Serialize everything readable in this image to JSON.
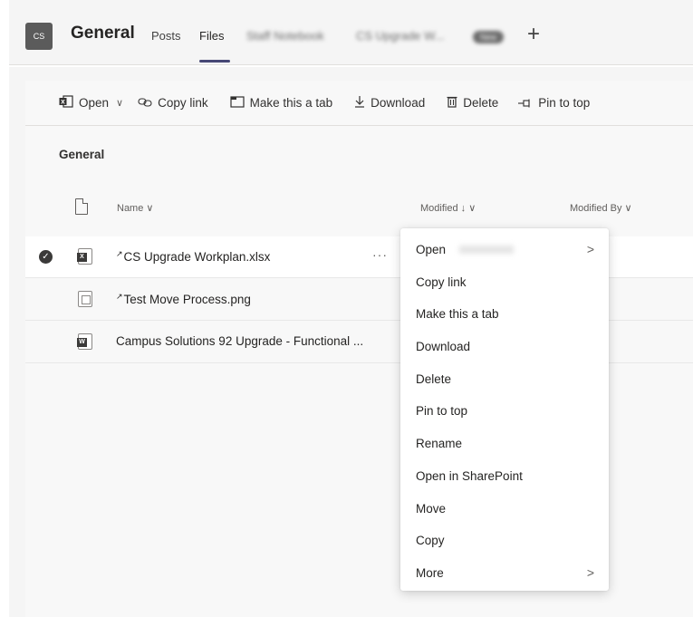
{
  "header": {
    "team_initials": "CS",
    "channel": "General",
    "tabs": [
      {
        "label": "Posts"
      },
      {
        "label": "Files",
        "active": true
      },
      {
        "label": "Staff Notebook"
      },
      {
        "label": "CS Upgrade W..."
      }
    ],
    "tab_badge": "New",
    "add_tab_icon": "+"
  },
  "toolbar": {
    "open": "Open",
    "copy_link": "Copy link",
    "make_tab": "Make this a tab",
    "download": "Download",
    "delete": "Delete",
    "pin": "Pin to top"
  },
  "breadcrumb": "General",
  "columns": {
    "name": "Name ∨",
    "modified": "Modified ↓ ∨",
    "modified_by": "Modified By ∨"
  },
  "files": [
    {
      "name": "CS Upgrade Workplan.xlsx",
      "type": "xlsx",
      "selected": true
    },
    {
      "name": "Test Move Process.png",
      "type": "png",
      "selected": false
    },
    {
      "name": "Campus Solutions 92 Upgrade - Functional ...",
      "type": "docx",
      "selected": false
    }
  ],
  "row_more": "···",
  "context_menu": {
    "items": [
      {
        "label": "Open",
        "submenu": true
      },
      {
        "label": "Copy link"
      },
      {
        "label": "Make this a tab"
      },
      {
        "label": "Download"
      },
      {
        "label": "Delete"
      },
      {
        "label": "Pin to top"
      },
      {
        "label": "Rename"
      },
      {
        "label": "Open in SharePoint"
      },
      {
        "label": "Move"
      },
      {
        "label": "Copy"
      },
      {
        "label": "More",
        "submenu": true
      }
    ]
  },
  "icons": {
    "excel": "excel-icon",
    "link": "link-icon",
    "tab": "tab-icon",
    "download": "download-icon",
    "delete": "trash-icon",
    "pin": "pin-icon",
    "chevron": "chevron-right-icon"
  },
  "colors": {
    "header_bg": "#f5f5f5",
    "tab_underline": "#464775",
    "avatar_bg": "#5b5b5b"
  }
}
